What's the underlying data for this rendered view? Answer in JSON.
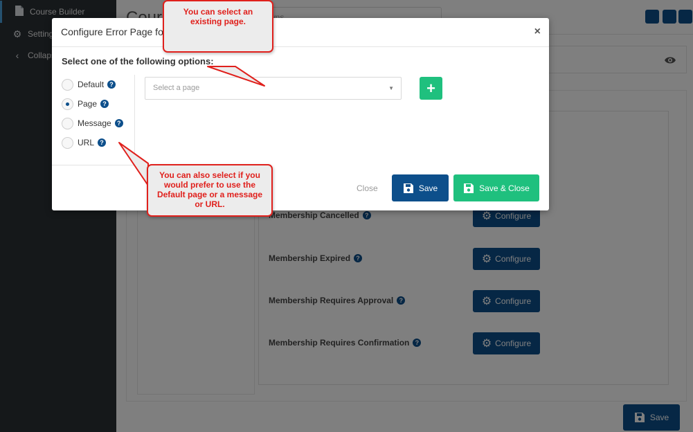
{
  "sidebar": {
    "items": [
      {
        "label": "Course Builder",
        "icon": "document-icon"
      },
      {
        "label": "Settings",
        "icon": "gear-icon"
      },
      {
        "label": "Collapse",
        "icon": "chevron-left-icon"
      }
    ]
  },
  "header": {
    "title": "Cours",
    "search_text": "wns"
  },
  "settings_rows": [
    {
      "label": "Membership Cancelled",
      "button": "Configure"
    },
    {
      "label": "Membership Expired",
      "button": "Configure"
    },
    {
      "label": "Membership Requires Approval",
      "button": "Configure"
    },
    {
      "label": "Membership Requires Confirmation",
      "button": "Configure"
    }
  ],
  "page_save_label": "Save",
  "modal": {
    "title": "Configure Error Page for",
    "close_icon": "×",
    "options_heading": "Select one of the following options:",
    "options": [
      {
        "label": "Default",
        "checked": false
      },
      {
        "label": "Page",
        "checked": true
      },
      {
        "label": "Message",
        "checked": false
      },
      {
        "label": "URL",
        "checked": false
      }
    ],
    "select_placeholder": "Select a page",
    "add_icon": "+",
    "close_label": "Close",
    "save_label": "Save",
    "save_close_label": "Save & Close"
  },
  "callouts": {
    "top": "You can select an existing page.",
    "bottom": "You can also select if you would prefer to use the Default page or a message or URL."
  },
  "colors": {
    "primary": "#0d4f8b",
    "success": "#1fc07e",
    "callout_red": "#e0201c",
    "sidebar_bg": "#2b3035"
  }
}
